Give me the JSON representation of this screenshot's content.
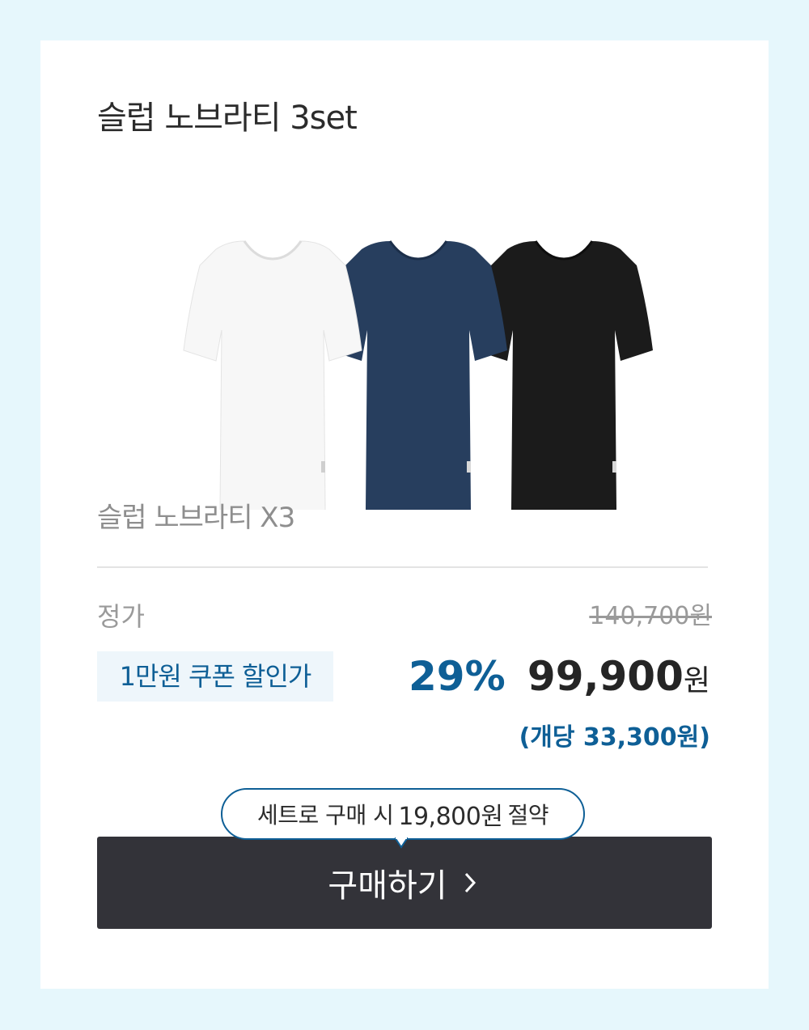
{
  "product": {
    "title": "슬럽 노브라티 3set",
    "subtitle": "슬럽 노브라티 X3",
    "image_alt": "white, navy and black t-shirts"
  },
  "pricing": {
    "list_label": "정가",
    "list_price": "140,700원",
    "coupon_label": "1만원 쿠폰 할인가",
    "discount_rate": "29%",
    "sale_price": "99,900",
    "sale_unit": "원",
    "per_unit": "(개당 33,300원)"
  },
  "promo": {
    "prefix": "세트로 구매 시",
    "amount": "19,800원",
    "suffix": "절약"
  },
  "cta": {
    "label": "구매하기",
    "icon": "chevron-right-icon"
  },
  "colors": {
    "background": "#e6f7fc",
    "accent": "#0e5f96",
    "button": "#333339",
    "shirt_white": "#f7f7f7",
    "shirt_navy": "#273e5e",
    "shirt_black": "#1b1b1b"
  }
}
